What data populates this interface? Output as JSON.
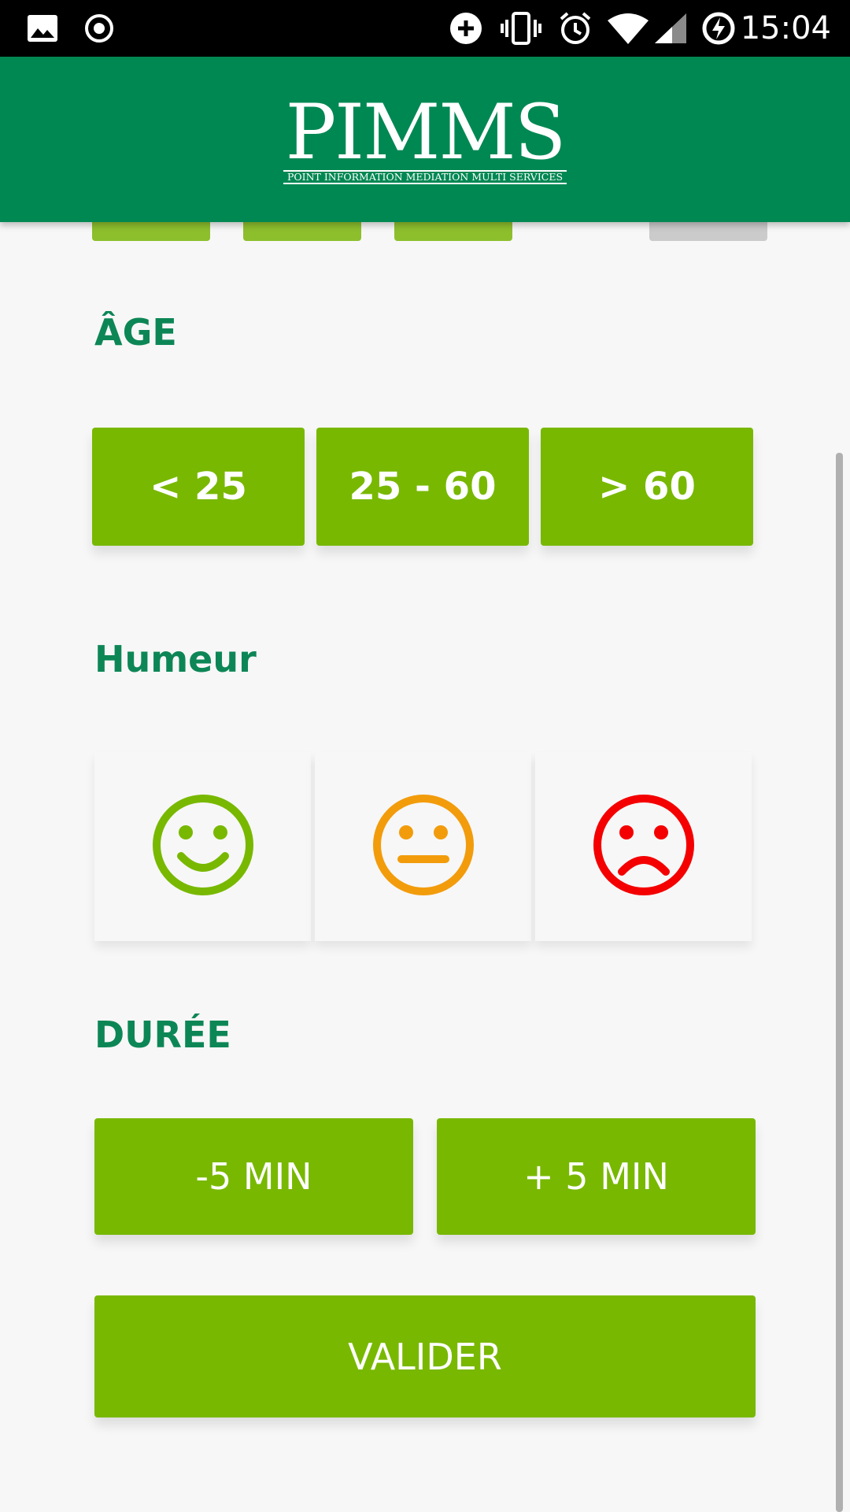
{
  "status_bar": {
    "time": "15:04",
    "icons": [
      "image-icon",
      "record-icon",
      "add-circle-icon",
      "vibrate-icon",
      "alarm-icon",
      "wifi-icon",
      "signal-icon",
      "battery-charging-icon"
    ]
  },
  "header": {
    "logo_text": "PIMMS",
    "logo_subtitle": "POINT INFORMATION MEDIATION MULTI SERVICES",
    "background_color": "#008853"
  },
  "age": {
    "title": "ÂGE",
    "options": [
      "< 25",
      "25 - 60",
      "> 60"
    ]
  },
  "mood": {
    "title": "Humeur",
    "options": [
      {
        "icon": "happy-face-icon",
        "color": "#78b800"
      },
      {
        "icon": "neutral-face-icon",
        "color": "#f29c0c"
      },
      {
        "icon": "sad-face-icon",
        "color": "#f40000"
      }
    ]
  },
  "duration": {
    "title": "DURÉE",
    "options": [
      "-5 MIN",
      "+ 5 MIN"
    ]
  },
  "submit_label": "VALIDER",
  "colors": {
    "accent": "#78b800",
    "title": "#0d8656",
    "background": "#f7f7f7"
  }
}
